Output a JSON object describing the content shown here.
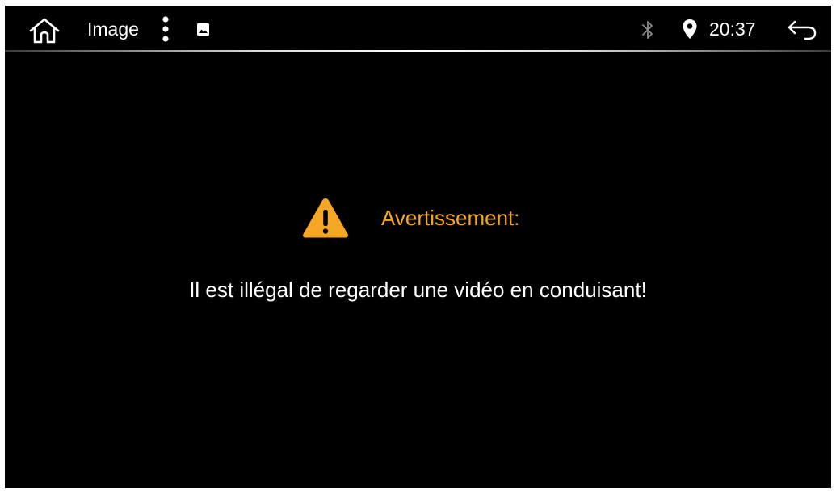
{
  "status_bar": {
    "app_title": "Image",
    "time": "20:37",
    "icons": {
      "home": "home-icon",
      "menu": "more-vert-icon",
      "image": "image-icon",
      "bluetooth": "bluetooth-icon",
      "location": "location-pin-icon",
      "back": "back-arrow-icon"
    }
  },
  "warning": {
    "title": "Avertissement:",
    "message": "Il est illégal de regarder une vidéo en conduisant!",
    "accent_color": "#f5a623"
  },
  "colors": {
    "background": "#000000",
    "text": "#ffffff",
    "bluetooth_inactive": "#8a8a8a"
  }
}
